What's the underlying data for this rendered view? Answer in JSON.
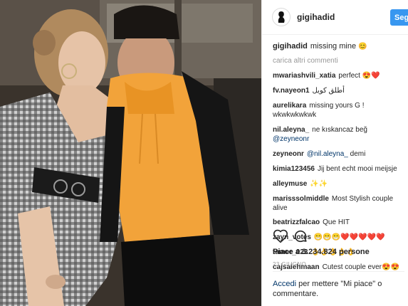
{
  "post": {
    "username": "gigihadid",
    "follow_label": "Segui"
  },
  "caption": {
    "user": "gigihadid",
    "text": "missing mine",
    "emoji": "😊"
  },
  "load_more_label": "carica altri commenti",
  "comments": [
    {
      "user": "mwariashvili_xatia",
      "text": "perfect",
      "emoji": "😍❤️"
    },
    {
      "user": "fv.nayeon1",
      "text": "أطلق كويل",
      "emoji": ""
    },
    {
      "user": "aurelikara",
      "text": "missing yours G ! wkwkwkwkwk",
      "emoji": ""
    },
    {
      "user": "nil.aleyna_",
      "text": "ne kıskancaz beğ",
      "mention": "@zeyneonr",
      "emoji": ""
    },
    {
      "user": "zeyneonr",
      "mention_first": "@nil.aleyna_",
      "text": "demi",
      "emoji": ""
    },
    {
      "user": "kimia123456",
      "text": "Jij bent echt mooi meijsje",
      "emoji": ""
    },
    {
      "user": "alleymuse",
      "text": "",
      "emoji": "✨✨"
    },
    {
      "user": "marisssolmiddle",
      "text": "Most Stylish couple alive",
      "emoji": ""
    },
    {
      "user": "beatrizzfalcao",
      "text": "Que HIT",
      "emoji": ""
    },
    {
      "user": "zayn_votes",
      "text": "",
      "emoji": "😁😁😁❤️❤️❤️❤️❤️"
    },
    {
      "user": "tamer_023",
      "text": "",
      "emoji": "👌👌👌👌👌"
    },
    {
      "user": "cajsalehmaan",
      "text": "Cutest couple ever",
      "emoji": "😍😍"
    }
  ],
  "likes_label": "Piace a 3.234.824 persone",
  "date_label": "23 GIUGNO",
  "login_prompt": {
    "link": "Accedi",
    "text": "per mettere \"Mi piace\" o commentare."
  },
  "colors": {
    "accent": "#3897f0",
    "link": "#003569",
    "muted": "#999999",
    "hoodie": "#f2a33a",
    "background": "#ffffff"
  },
  "icons": [
    "heart-icon",
    "comment-icon",
    "avatar-logo-icon"
  ]
}
